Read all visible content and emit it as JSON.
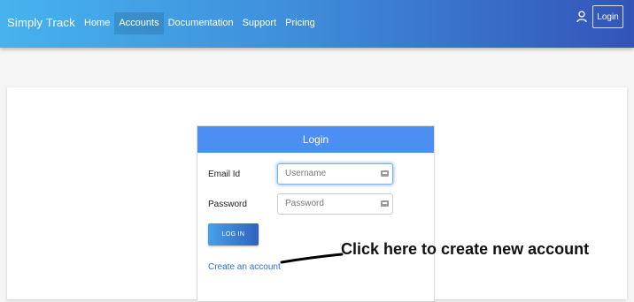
{
  "navbar": {
    "brand": "Simply Track",
    "links": [
      "Home",
      "Accounts",
      "Documentation",
      "Support",
      "Pricing"
    ],
    "active_link": "Accounts",
    "user_icon": "user-icon",
    "login_label": "Login"
  },
  "login_form": {
    "title": "Login",
    "email_label": "Email Id",
    "email_placeholder": "Username",
    "password_label": "Password",
    "password_placeholder": "Password",
    "submit_label": "LOG IN",
    "create_account_label": "Create an account"
  },
  "annotation": {
    "text": "Click here to create new account"
  },
  "colors": {
    "nav_gradient_start": "#46b3ee",
    "nav_gradient_end": "#3354b9",
    "panel_header": "#4c8ef2",
    "link": "#2f6fd1"
  }
}
